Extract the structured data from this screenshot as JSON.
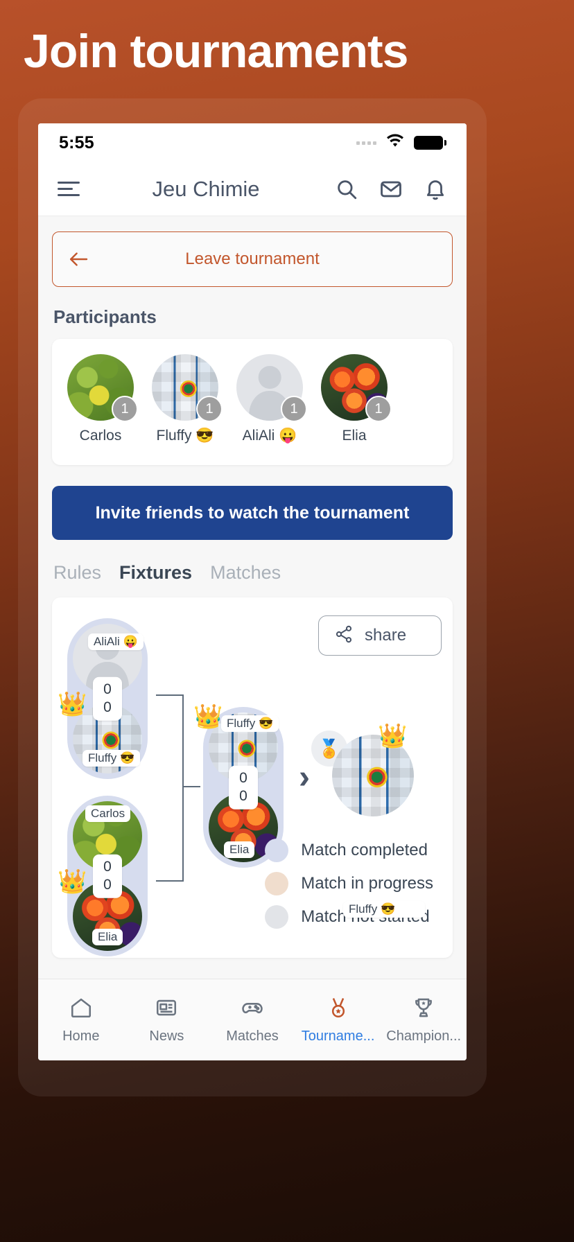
{
  "banner": {
    "title": "Join tournaments"
  },
  "statusbar": {
    "time": "5:55",
    "wifi_icon": "wifi-icon",
    "battery_icon": "battery-icon",
    "signal_icon": "signal-dots-icon"
  },
  "appbar": {
    "menu_icon": "hamburger-menu-icon",
    "title": "Jeu Chimie",
    "search_icon": "search-icon",
    "mail_icon": "mail-icon",
    "bell_icon": "bell-icon"
  },
  "leave": {
    "label": "Leave tournament",
    "icon": "arrow-left-icon",
    "color": "#c2562c"
  },
  "participants": {
    "heading": "Participants",
    "items": [
      {
        "name": "Carlos",
        "badge": "1",
        "avatar": "leaves-photo"
      },
      {
        "name": "Fluffy 😎",
        "badge": "1",
        "avatar": "collage-photo"
      },
      {
        "name": "AliAli 😛",
        "badge": "1",
        "avatar": "default-person-photo"
      },
      {
        "name": "Elia",
        "badge": "1",
        "avatar": "flowers-photo"
      }
    ]
  },
  "invite": {
    "label": "Invite friends to watch the tournament",
    "color": "#1f4490"
  },
  "tabs": [
    {
      "label": "Rules",
      "active": false
    },
    {
      "label": "Fixtures",
      "active": true
    },
    {
      "label": "Matches",
      "active": false
    }
  ],
  "bracket": {
    "share": {
      "label": "share",
      "icon": "share-icon"
    },
    "matches": [
      {
        "id": "semifinal-1",
        "status": "completed",
        "top": {
          "name": "AliAli 😛",
          "score": "0",
          "avatar": "default-person-photo",
          "winner": false
        },
        "bottom": {
          "name": "Fluffy 😎",
          "score": "0",
          "avatar": "collage-photo",
          "winner": true
        }
      },
      {
        "id": "semifinal-2",
        "status": "completed",
        "top": {
          "name": "Carlos",
          "score": "0",
          "avatar": "leaves-photo",
          "winner": false
        },
        "bottom": {
          "name": "Elia",
          "score": "0",
          "avatar": "flowers-photo",
          "winner": true
        }
      },
      {
        "id": "final",
        "status": "completed",
        "top": {
          "name": "Fluffy 😎",
          "score": "0",
          "avatar": "collage-photo",
          "winner": true
        },
        "bottom": {
          "name": "Elia",
          "score": "0",
          "avatar": "flowers-photo",
          "winner": false
        }
      }
    ],
    "champion": {
      "name": "Fluffy 😎",
      "avatar": "collage-photo",
      "medal_icon": "medal-icon",
      "crown_icon": "crown-icon",
      "chevron_icon": "chevron-right-icon"
    },
    "legend": [
      {
        "label": "Match completed",
        "color": "#d6dcee"
      },
      {
        "label": "Match in progress",
        "color": "#f0ddcd"
      },
      {
        "label": "Match not started",
        "color": "#e2e4e8"
      }
    ]
  },
  "bottomnav": [
    {
      "label": "Home",
      "icon": "home-icon",
      "active": false
    },
    {
      "label": "News",
      "icon": "news-icon",
      "active": false
    },
    {
      "label": "Matches",
      "icon": "gamepad-icon",
      "active": false
    },
    {
      "label": "Tourname...",
      "icon": "medal-icon",
      "active": true
    },
    {
      "label": "Champion...",
      "icon": "trophy-icon",
      "active": false
    }
  ]
}
